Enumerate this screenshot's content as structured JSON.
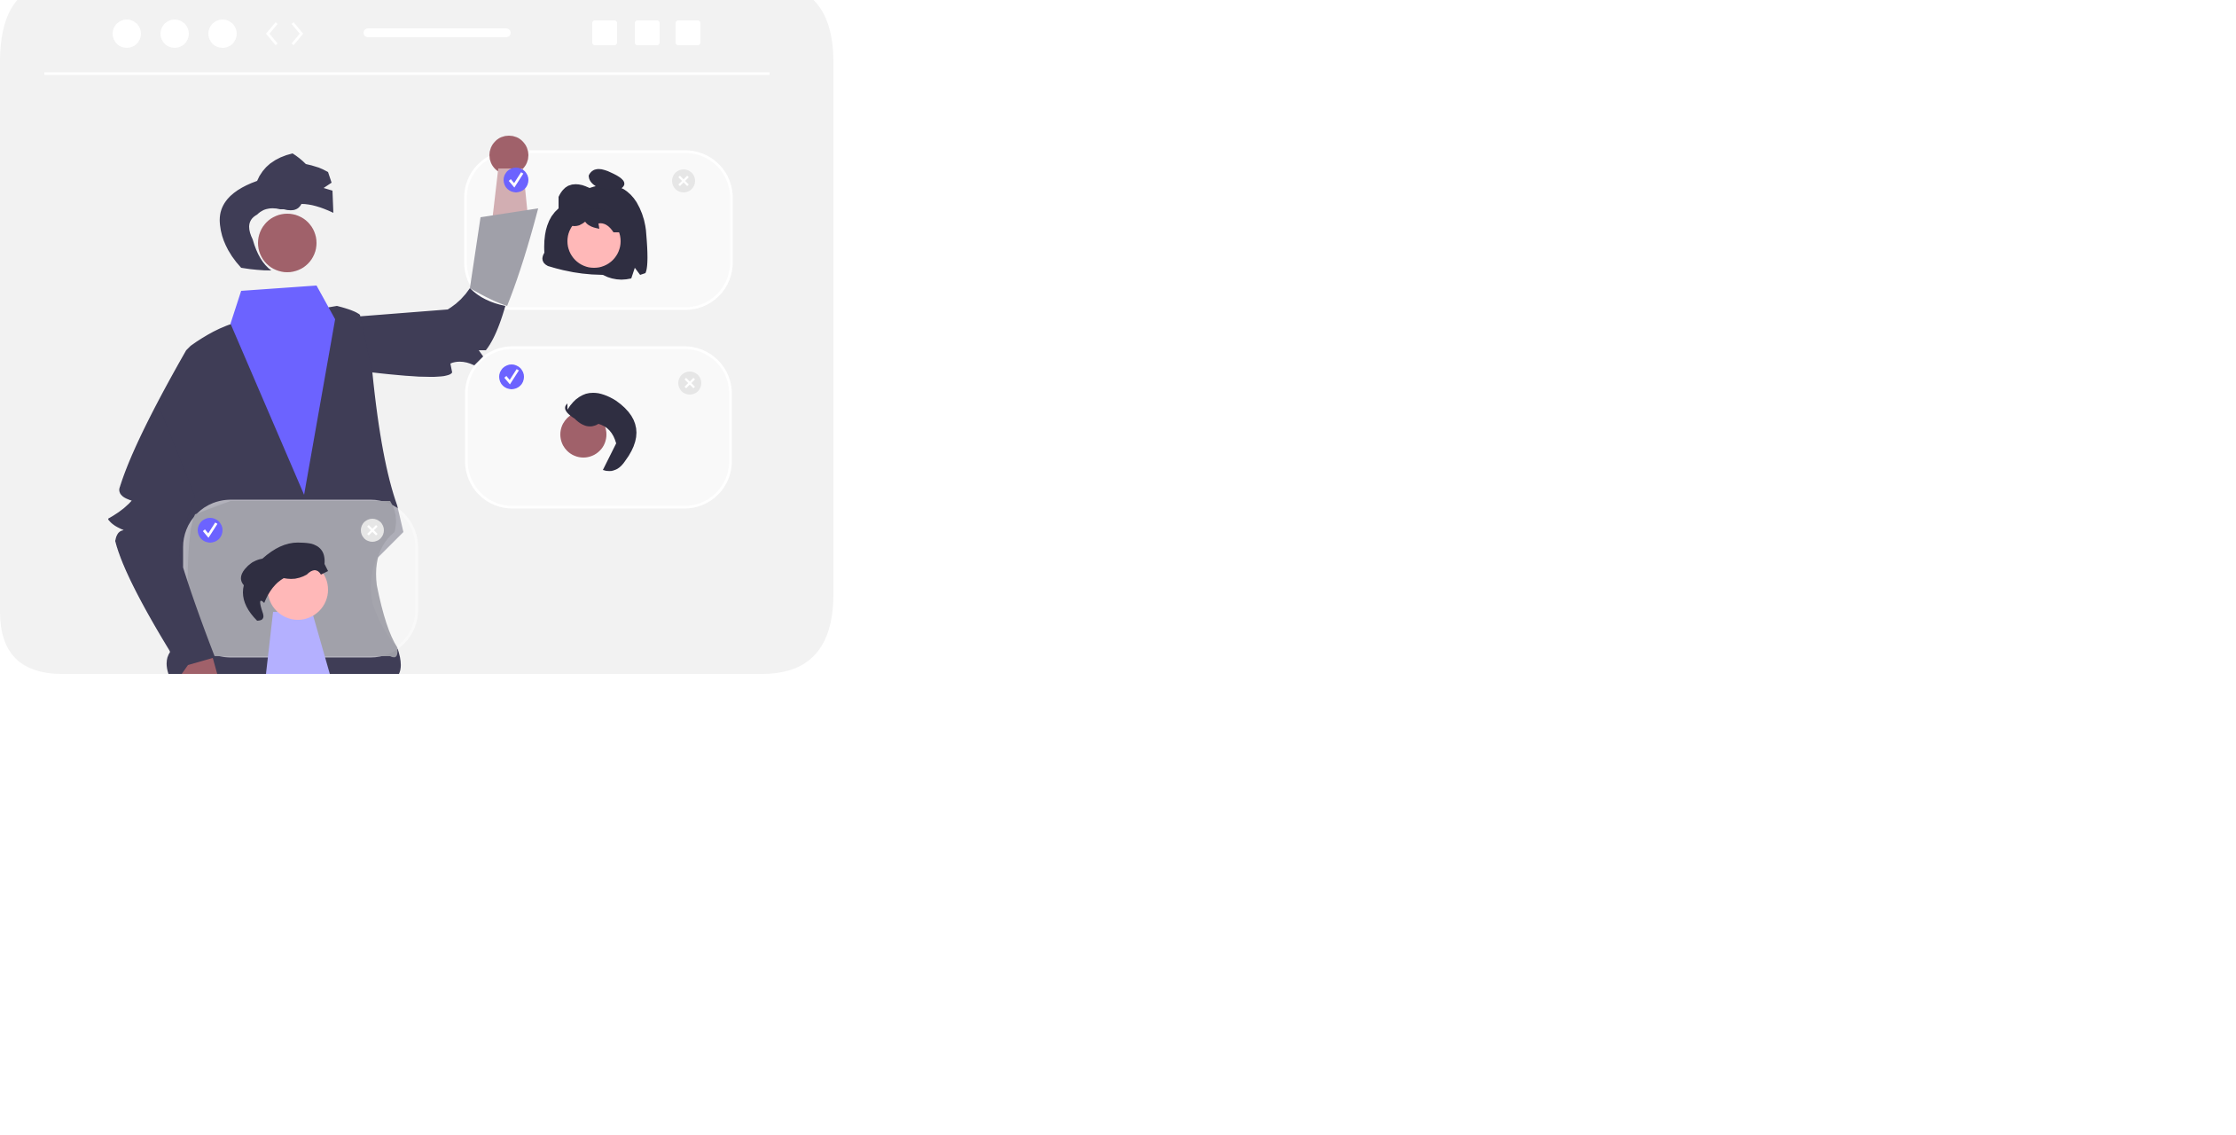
{
  "window": {
    "controls": [
      "dot",
      "dot",
      "dot"
    ],
    "nav_icons": [
      "chevron-left-icon",
      "chevron-right-icon"
    ],
    "action_icons": [
      "square-icon",
      "square-icon",
      "square-icon"
    ]
  },
  "cards": [
    {
      "name": "profile-card-top",
      "check_icon": "check-icon",
      "close_icon": "close-icon"
    },
    {
      "name": "profile-card-middle",
      "check_icon": "check-icon",
      "close_icon": "close-icon"
    },
    {
      "name": "profile-card-bottom",
      "check_icon": "check-icon",
      "close_icon": "close-icon"
    }
  ],
  "colors": {
    "window_bg": "#f2f2f2",
    "card_bg": "#f9f9f9",
    "accent": "#6c63ff",
    "accent_light": "#b4b0ff",
    "dark": "#3f3d56",
    "hair": "#2f2e41",
    "skin_dark": "#a0616a",
    "skin_light": "#ffb8b8",
    "close_gray": "#e6e6e6"
  }
}
